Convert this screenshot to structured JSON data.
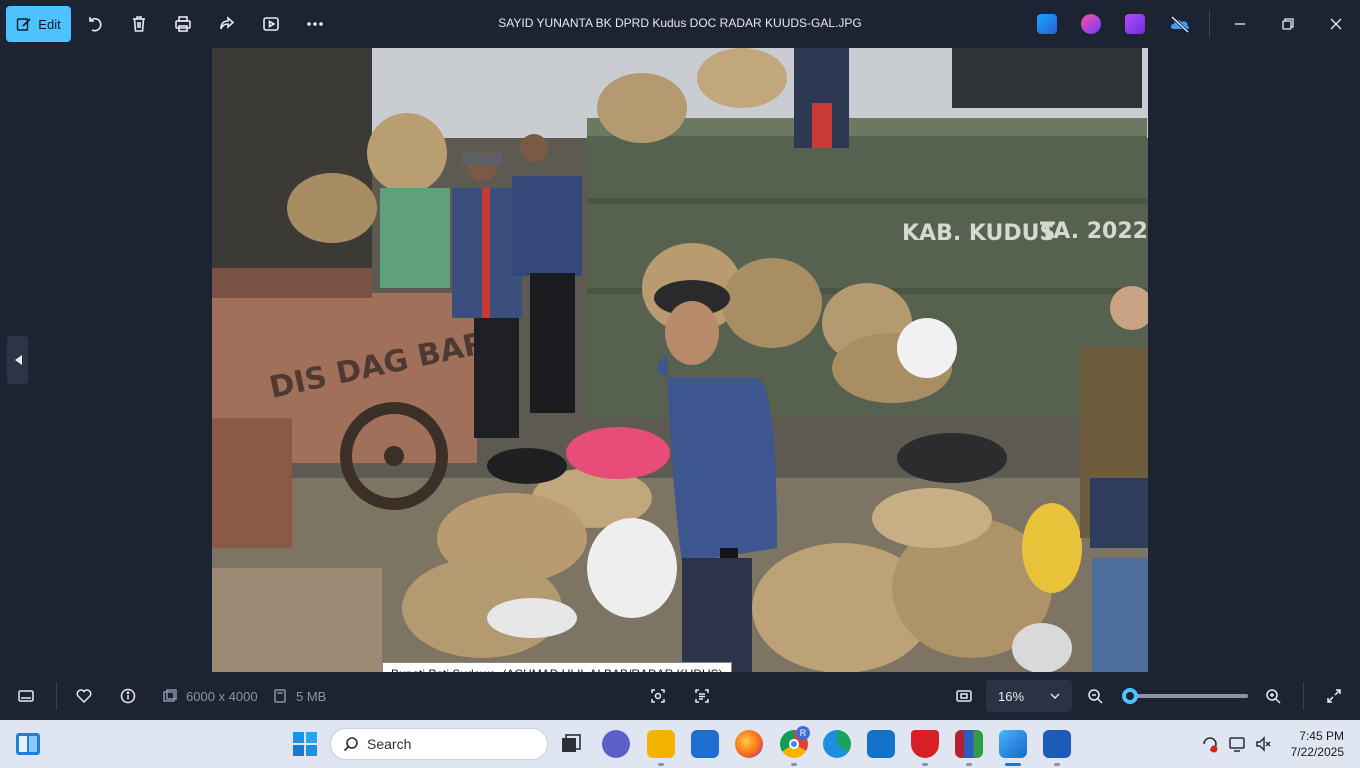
{
  "toolbar": {
    "edit_label": "Edit",
    "icons": [
      "rotate-icon",
      "delete-icon",
      "print-icon",
      "share-icon",
      "slideshow-icon",
      "more-icon"
    ]
  },
  "window": {
    "title": "SAYID YUNANTA  BK DPRD Kudus DOC RADAR KUUDS-GAL.JPG"
  },
  "photo": {
    "caption": "Bupati Pati Sudewo. (ACHMAD ULIL ALBAB/RADAR KUDUS)",
    "cart_text": "DIS DAG BAR",
    "container_text_1": "KAB. KUDUS",
    "container_text_2": "TA. 2022"
  },
  "info": {
    "dimensions": "6000 x 4000",
    "size": "5 MB",
    "zoom": "16%",
    "zoom_level_percent": 0
  },
  "taskbar": {
    "search_placeholder": "Search",
    "time": "7:45 PM",
    "date": "7/22/2025",
    "chrome_badge": "R"
  },
  "colors": {
    "accent": "#4cc2ff",
    "background": "#1c2333",
    "taskbar": "#dfe6f1"
  }
}
